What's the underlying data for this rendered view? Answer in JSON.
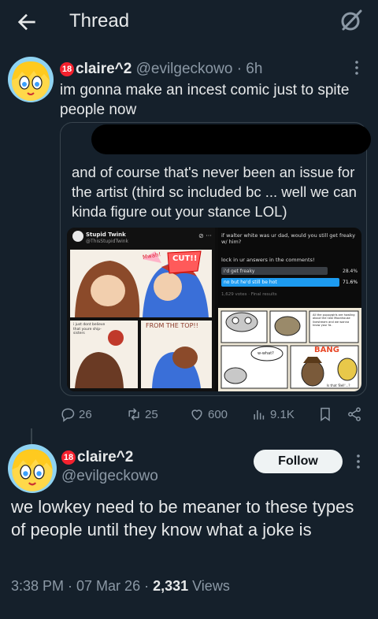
{
  "header": {
    "title": "Thread",
    "back_icon": "back-arrow-icon",
    "grok_icon": "grok-icon"
  },
  "post1": {
    "badge": "18",
    "display_name": "claire^2",
    "handle": "@evilgeckowo",
    "time": "· 6h",
    "text": "im gonna make an incest comic just to spite people now",
    "quote": {
      "text": "and of course that's never been an issue for the artist (third sc included bc ... well we can kinda figure out your stance LOL)",
      "image": {
        "left": {
          "account_name": "Stupid Twink",
          "account_handle": "@ThisStupidTwink",
          "bubble_1": "Mwah!",
          "bubble_2": "CUT!!",
          "bubble_3": "FROM THE TOP!!",
          "caption": "i just dont believe that youre ship-sisters"
        },
        "right": {
          "question": "if walter white was ur dad, would you still get freaky w/ him?",
          "prompt": "lock in ur answers in the comments!",
          "option_1": "i'd get freaky",
          "option_1_pct": "28.4%",
          "option_2": "no but he'd still be hot",
          "option_2_pct": "71.6%",
          "footer": "1,629 votes · Final results",
          "bubble_what": "w-what?",
          "puppy_note": "All the puppygirls are howling about the new Moonhouse livestream and we wanna know your fa-",
          "bang": "BANG",
          "bottom_text": "Is that 'Bell'...?"
        }
      }
    },
    "stats": {
      "replies": "26",
      "reposts": "25",
      "likes": "600",
      "views": "9.1K"
    }
  },
  "post2": {
    "badge": "18",
    "display_name": "claire^2",
    "handle": "@evilgeckowo",
    "follow_label": "Follow",
    "text": "we lowkey need to be meaner to these types of people until they know what a joke is",
    "timestamp": "3:38 PM · 07 Mar 26 · ",
    "views_count": "2,331",
    "views_label": " Views"
  },
  "colors": {
    "background": "#15202b",
    "text": "#e7e9ea",
    "muted": "#8b98a5",
    "border": "#38444d",
    "badge": "#f4212e",
    "poll_blue": "#1d9bf0"
  }
}
